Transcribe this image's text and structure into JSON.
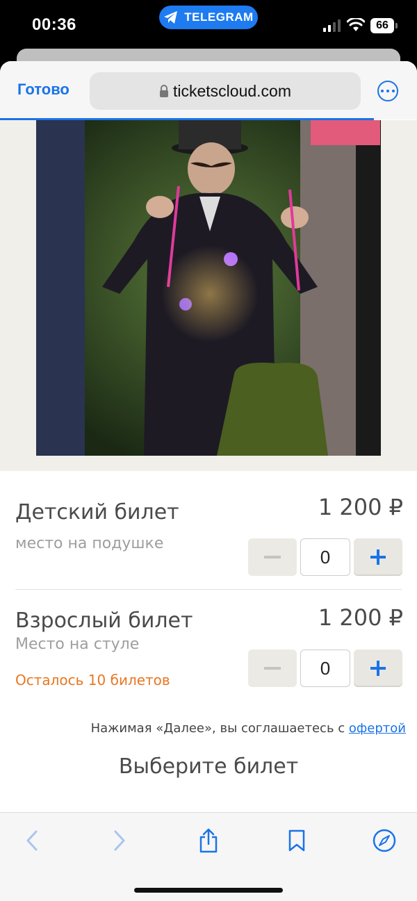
{
  "status_bar": {
    "time": "00:36",
    "app_pill": "TELEGRAM",
    "battery": "66"
  },
  "browser": {
    "done_label": "Готово",
    "url": "ticketscloud.com"
  },
  "tickets": [
    {
      "name": "Детский билет",
      "subtitle": "место на подушке",
      "price": "1 200  ₽",
      "quantity": "0",
      "remaining": ""
    },
    {
      "name": "Взрослый билет",
      "subtitle": "Место на стуле",
      "price": "1 200  ₽",
      "quantity": "0",
      "remaining": "Осталось 10 билетов"
    }
  ],
  "agreement": {
    "text": "Нажимая «Далее», вы соглашаетесь с ",
    "link": "офертой"
  },
  "cta": "Выберите билет",
  "colors": {
    "accent": "#1a73e8",
    "warning": "#e87722",
    "telegram": "#1e7bf0"
  }
}
